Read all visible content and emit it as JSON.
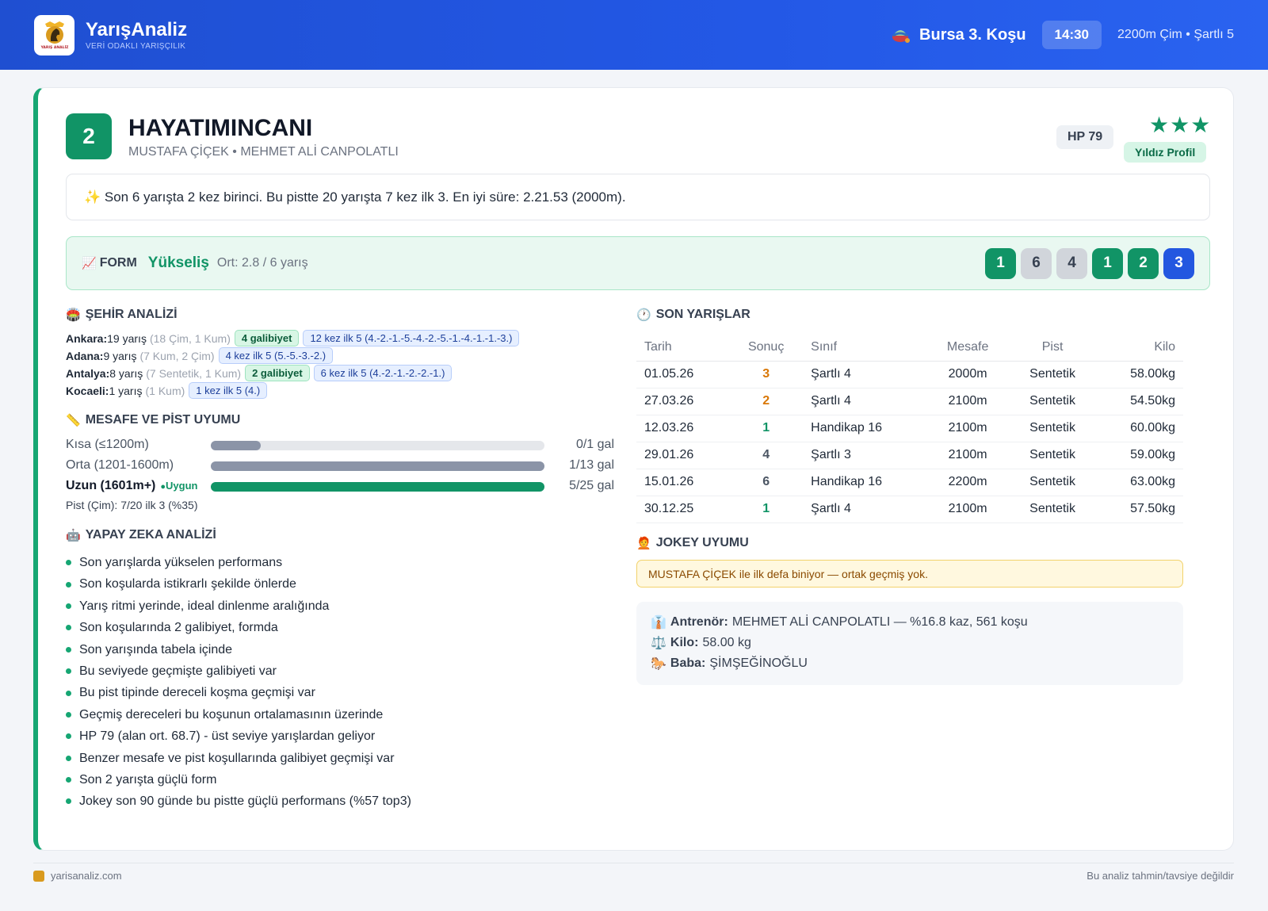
{
  "header": {
    "brand": "YarışAnaliz",
    "tagline": "VERİ ODAKLI YARIŞÇILIK",
    "logo_text": "YARIŞ ANALİZ",
    "race_title": "Bursa 3. Koşu",
    "time": "14:30",
    "conditions": "2200m Çim • Şartlı 5"
  },
  "horse": {
    "number": "2",
    "name": "HAYATIMINCANI",
    "sub": "MUSTAFA ÇİÇEK • MEHMET ALİ CANPOLATLI",
    "hp": "HP 79",
    "stars": "★★★",
    "star_label": "Yıldız Profil",
    "summary": "✨ Son 6 yarışta 2 kez birinci. Bu pistte 20 yarışta 7 kez ilk 3. En iyi süre: 2.21.53 (2000m)."
  },
  "form": {
    "icon": "📈",
    "label": "FORM",
    "trend": "Yükseliş",
    "avg": "Ort: 2.8 / 6 yarış",
    "results": [
      {
        "v": "1",
        "bg": "#119466",
        "fg": "#ffffff"
      },
      {
        "v": "6",
        "bg": "#d1d5db",
        "fg": "#374151"
      },
      {
        "v": "4",
        "bg": "#d1d5db",
        "fg": "#374151"
      },
      {
        "v": "1",
        "bg": "#119466",
        "fg": "#ffffff"
      },
      {
        "v": "2",
        "bg": "#119466",
        "fg": "#ffffff"
      },
      {
        "v": "3",
        "bg": "#2357e0",
        "fg": "#ffffff"
      }
    ]
  },
  "city": {
    "title": "ŞEHİR ANALİZİ",
    "icon": "🏟️",
    "rows": [
      {
        "city": "Ankara:",
        "count": " 19 yarış",
        "detail": "(18 Çim, 1 Kum)",
        "win": "4 galibiyet",
        "top": "12 kez ilk 5 (4.-2.-1.-5.-4.-2.-5.-1.-4.-1.-1.-3.)"
      },
      {
        "city": "Adana:",
        "count": " 9 yarış",
        "detail": "(7 Kum, 2 Çim)",
        "win": "",
        "top": "4 kez ilk 5 (5.-5.-3.-2.)"
      },
      {
        "city": "Antalya:",
        "count": " 8 yarış",
        "detail": "(7 Sentetik, 1 Kum)",
        "win": "2 galibiyet",
        "top": "6 kez ilk 5 (4.-2.-1.-2.-2.-1.)"
      },
      {
        "city": "Kocaeli:",
        "count": " 1 yarış",
        "detail": "(1 Kum)",
        "win": "",
        "top": "1 kez ilk 5 (4.)"
      }
    ]
  },
  "distance": {
    "title": "MESAFE VE PİST UYUMU",
    "icon": "📏",
    "rows": [
      {
        "label": "Kısa (≤1200m)",
        "value": "0/1 gal",
        "fill": 0.15,
        "color": "#8b94a7",
        "bold": false,
        "tag": ""
      },
      {
        "label": "Orta (1201-1600m)",
        "value": "1/13 gal",
        "fill": 1.0,
        "color": "#8b94a7",
        "bold": false,
        "tag": ""
      },
      {
        "label": "Uzun (1601m+)",
        "value": "5/25 gal",
        "fill": 1.0,
        "color": "#119466",
        "bold": true,
        "tag": "Uygun"
      }
    ],
    "track": "Pist (Çim): 7/20 ilk 3 (%35)"
  },
  "ai": {
    "title": "YAPAY ZEKA ANALİZİ",
    "icon": "🤖",
    "items": [
      "Son yarışlarda yükselen performans",
      "Son koşularda istikrarlı şekilde önlerde",
      "Yarış ritmi yerinde, ideal dinlenme aralığında",
      "Son koşularında 2 galibiyet, formda",
      "Son yarışında tabela içinde",
      "Bu seviyede geçmişte galibiyeti var",
      "Bu pist tipinde dereceli koşma geçmişi var",
      "Geçmiş dereceleri bu koşunun ortalamasının üzerinde",
      "HP 79 (alan ort. 68.7) - üst seviye yarışlardan geliyor",
      "Benzer mesafe ve pist koşullarında galibiyet geçmişi var",
      "Son 2 yarışta güçlü form",
      "Jokey son 90 günde bu pistte güçlü performans (%57 top3)"
    ]
  },
  "recent": {
    "title": "SON YARIŞLAR",
    "icon": "🕐",
    "columns": [
      "Tarih",
      "Sonuç",
      "Sınıf",
      "Mesafe",
      "Pist",
      "Kilo"
    ],
    "rows": [
      {
        "date": "01.05.26",
        "result": "3",
        "color": "#d97706",
        "class": "Şartlı 4",
        "dist": "2000m",
        "track": "Sentetik",
        "kg": "58.00kg"
      },
      {
        "date": "27.03.26",
        "result": "2",
        "color": "#d97706",
        "class": "Şartlı 4",
        "dist": "2100m",
        "track": "Sentetik",
        "kg": "54.50kg"
      },
      {
        "date": "12.03.26",
        "result": "1",
        "color": "#119466",
        "class": "Handikap 16",
        "dist": "2100m",
        "track": "Sentetik",
        "kg": "60.00kg"
      },
      {
        "date": "29.01.26",
        "result": "4",
        "color": "#4b5563",
        "class": "Şartlı 3",
        "dist": "2100m",
        "track": "Sentetik",
        "kg": "59.00kg"
      },
      {
        "date": "15.01.26",
        "result": "6",
        "color": "#4b5563",
        "class": "Handikap 16",
        "dist": "2200m",
        "track": "Sentetik",
        "kg": "63.00kg"
      },
      {
        "date": "30.12.25",
        "result": "1",
        "color": "#119466",
        "class": "Şartlı 4",
        "dist": "2100m",
        "track": "Sentetik",
        "kg": "57.50kg"
      }
    ]
  },
  "jockey": {
    "title": "JOKEY UYUMU",
    "icon": "🧑‍🦰",
    "note": "MUSTAFA ÇİÇEK ile ilk defa biniyor — ortak geçmiş yok."
  },
  "trainer": {
    "trainer_label": "Antrenör:",
    "trainer_value": " MEHMET ALİ CANPOLATLI — %16.8 kaz, 561 koşu",
    "weight_label": "Kilo:",
    "weight_value": " 58.00 kg",
    "sire_label": "Baba:",
    "sire_value": " ŞİMŞEĞİNOĞLU"
  },
  "footer": {
    "site": "yarisanaliz.com",
    "disclaimer": "Bu analiz tahmin/tavsiye değildir"
  },
  "colors": {
    "accent": "#119466",
    "brand": "#2358e6"
  }
}
